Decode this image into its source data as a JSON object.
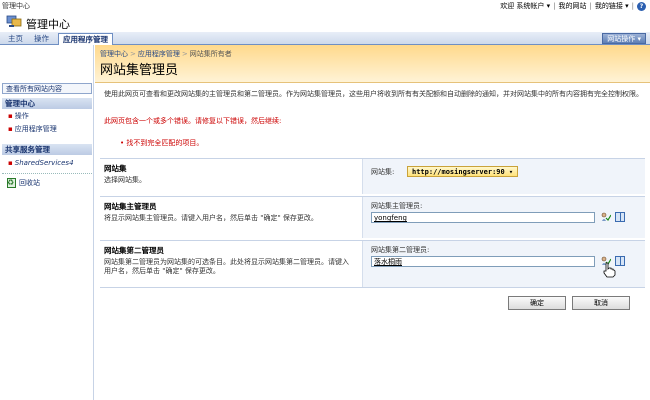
{
  "topbar": {
    "site_label": "管理中心",
    "welcome": "欢迎 系统帐户 ▾",
    "my_site": "我的网站",
    "my_links": "我的链接 ▾"
  },
  "header": {
    "title": "管理中心"
  },
  "tabs": [
    {
      "label": "主页"
    },
    {
      "label": "操作"
    },
    {
      "label": "应用程序管理"
    }
  ],
  "site_actions": "网站操作 ▾",
  "leftnav": {
    "view_all": "查看所有网站内容",
    "section1": "管理中心",
    "items1": [
      "操作",
      "应用程序管理"
    ],
    "section2": "共享服务管理",
    "items2": [
      "SharedServices4"
    ],
    "recycle": "回收站"
  },
  "breadcrumb": {
    "items": [
      "管理中心",
      "应用程序管理",
      "网站集所有者"
    ]
  },
  "page": {
    "title": "网站集管理员",
    "description": "使用此网页可查看和更改网站集的主管理员和第二管理员。作为网站集管理员，这些用户将收到所有有关配额和自动删除的通知，并对网站集中的所有内容拥有完全控制权限。",
    "error_intro": "此网页包含一个或多个错误。请修复以下错误，然后继续:",
    "error_item": "• 找不到完全匹配的项目。"
  },
  "sections": {
    "site_collection": {
      "heading": "网站集",
      "desc": "选择网站集。",
      "field_label": "网站集:",
      "value": "http://mosingserver:90 ▾"
    },
    "primary_admin": {
      "heading": "网站集主管理员",
      "desc": "将显示网站集主管理员。请键入用户名，然后单击 \"确定\" 保存更改。",
      "field_label": "网站集主管理员:",
      "value": "yongfeng"
    },
    "secondary_admin": {
      "heading": "网站集第二管理员",
      "desc": "网站集第二管理员为网站集的可选条目。此处将显示网站集第二管理员。请键入用户名，然后单击 \"确定\" 保存更改。",
      "field_label": "网站集第二管理员:",
      "value": "落水桐雨"
    }
  },
  "buttons": {
    "ok": "确定",
    "cancel": "取消"
  }
}
